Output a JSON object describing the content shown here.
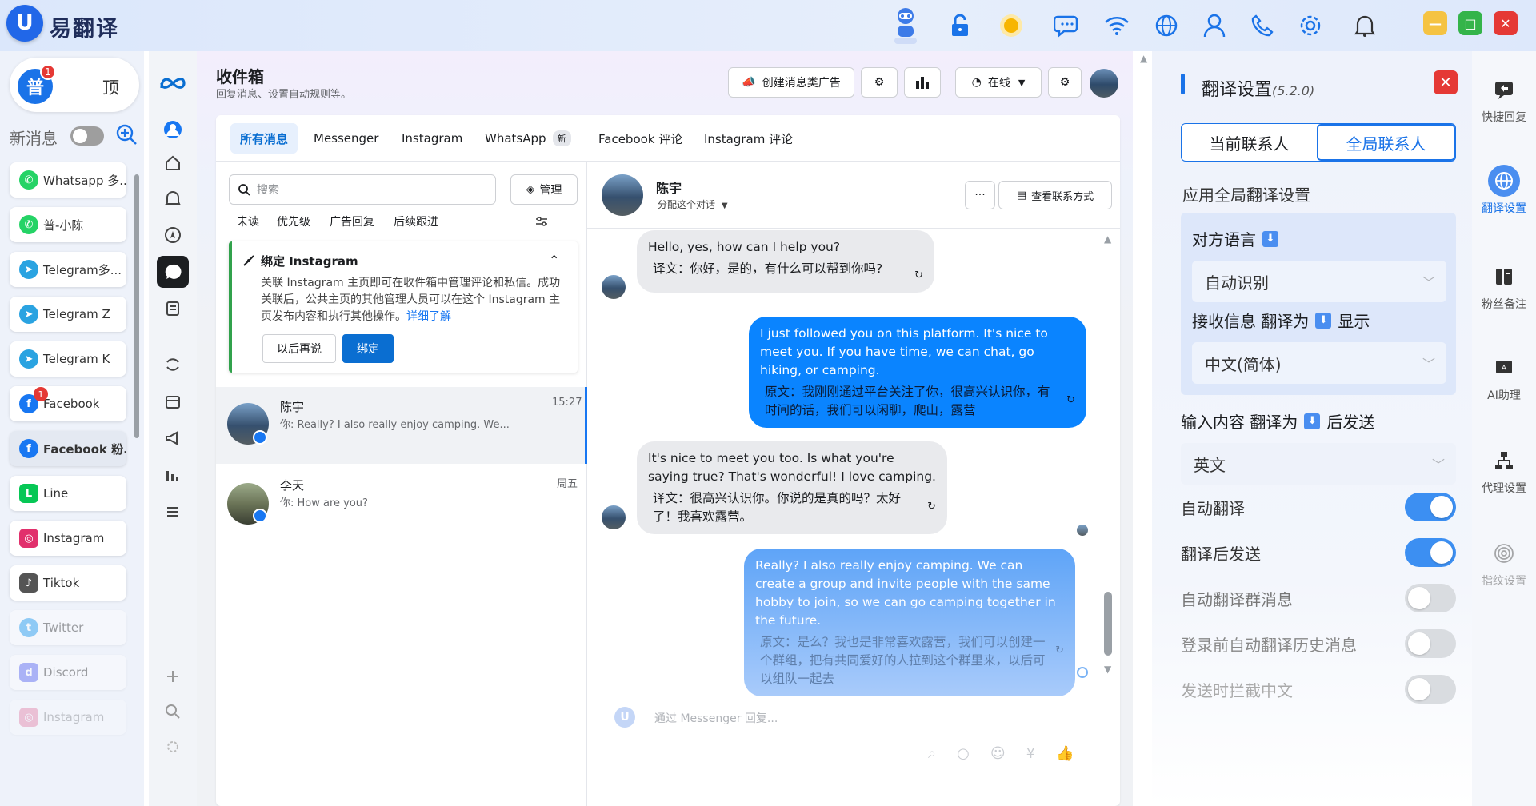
{
  "app": {
    "logo": "U",
    "name": "易翻译"
  },
  "titlebar": {
    "icons": [
      "robot-icon",
      "unlock-icon",
      "sun-icon",
      "chat-bubbles-icon",
      "wifi-icon",
      "globe-icon",
      "user-icon",
      "phone-icon",
      "gear-icon",
      "bell-icon"
    ],
    "window_buttons": [
      "minimize",
      "maximize",
      "close"
    ]
  },
  "account_sidebar": {
    "toggle_left": "普",
    "toggle_badge": "1",
    "toggle_right": "顶",
    "new_message_label": "新消息",
    "accounts": [
      {
        "label": "Whatsapp 多...",
        "icon": "whatsapp-icon",
        "color": "#25d366"
      },
      {
        "label": "普-小陈",
        "icon": "whatsapp-icon",
        "color": "#25d366"
      },
      {
        "label": "Telegram多...",
        "icon": "telegram-icon",
        "color": "#2aa3e1"
      },
      {
        "label": "Telegram Z",
        "icon": "telegram-icon",
        "color": "#2aa3e1"
      },
      {
        "label": "Telegram K",
        "icon": "telegram-icon",
        "color": "#2aa3e1"
      },
      {
        "label": "Facebook",
        "icon": "facebook-icon",
        "color": "#1877f2",
        "badge": "1"
      },
      {
        "label": "Facebook 粉...",
        "icon": "facebook-icon",
        "color": "#1877f2"
      },
      {
        "label": "Line",
        "icon": "line-icon",
        "color": "#06c755"
      },
      {
        "label": "Instagram",
        "icon": "instagram-icon",
        "color": "#e1306c"
      },
      {
        "label": "Tiktok",
        "icon": "tiktok-icon",
        "color": "#111111"
      },
      {
        "label": "Twitter",
        "icon": "twitter-icon",
        "color": "#1d9bf0"
      },
      {
        "label": "Discord",
        "icon": "discord-icon",
        "color": "#5865f2"
      },
      {
        "label": "Instagram",
        "icon": "instagram-icon",
        "color": "#e1306c"
      }
    ]
  },
  "inbox": {
    "title": "收件箱",
    "subtitle": "回复消息、设置自动规则等。",
    "create_ad_label": "创建消息类广告",
    "status_label": "在线",
    "tabs": [
      {
        "label": "所有消息"
      },
      {
        "label": "Messenger"
      },
      {
        "label": "Instagram"
      },
      {
        "label": "WhatsApp",
        "badge": "新"
      },
      {
        "label": "Facebook 评论"
      },
      {
        "label": "Instagram 评论"
      }
    ],
    "search_placeholder": "搜索",
    "manage_label": "管理",
    "filters": [
      "未读",
      "优先级",
      "广告回复",
      "后续跟进"
    ],
    "bind_card": {
      "title": "绑定 Instagram",
      "desc": "关联 Instagram 主页即可在收件箱中管理评论和私信。成功关联后，公共主页的其他管理人员可以在这个 Instagram 主页发布内容和执行其他操作。",
      "link": "详细了解",
      "later_label": "以后再说",
      "bind_label": "绑定"
    },
    "conversations": [
      {
        "name": "陈宇",
        "preview": "你: Really? I also really enjoy camping. We...",
        "time": "15:27"
      },
      {
        "name": "李天",
        "preview": "你: How are you?",
        "time": "周五"
      }
    ]
  },
  "chat": {
    "contact_name": "陈宇",
    "assign_label": "分配这个对话",
    "more_label": "···",
    "contact_info_label": "查看联系方式",
    "messages": [
      {
        "dir": "in",
        "text": "Hello, yes, how can I help you?",
        "translation": "译文：你好，是的，有什么可以帮到你吗?"
      },
      {
        "dir": "out",
        "text": "I just followed you on this platform. It's nice to meet you. If you have time, we can chat, go hiking, or camping.",
        "translation": "原文：我刚刚通过平台关注了你，很高兴认识你，有时间的话，我们可以闲聊，爬山，露营"
      },
      {
        "dir": "in",
        "text": "It's nice to meet you too. Is what you're saying true? That's wonderful! I love camping.",
        "translation": "译文：很高兴认识你。你说的是真的吗？太好了！我喜欢露营。"
      },
      {
        "dir": "out",
        "text": "Really? I also really enjoy camping. We can create a group and invite people with the same hobby to join, so we can go camping together in the future.",
        "translation": "原文：是么？我也是非常喜欢露营，我们可以创建一个群组，把有共同爱好的人拉到这个群里来，以后可以组队一起去"
      }
    ],
    "composer_placeholder": "通过 Messenger 回复..."
  },
  "translation_settings": {
    "title": "翻译设置",
    "version": "(5.2.0)",
    "segment": [
      "当前联系人",
      "全局联系人"
    ],
    "apply_global": "应用全局翻译设置",
    "other_language_label": "对方语言",
    "other_language_value": "自动识别",
    "receive_label_a": "接收信息 翻译为",
    "receive_label_b": "显示",
    "receive_value": "中文(简体)",
    "input_label_a": "输入内容 翻译为",
    "input_label_b": "后发送",
    "input_value": "英文",
    "switches": [
      {
        "label": "自动翻译",
        "on": true
      },
      {
        "label": "翻译后发送",
        "on": true
      },
      {
        "label": "自动翻译群消息",
        "on": false
      },
      {
        "label": "登录前自动翻译历史消息",
        "on": false
      },
      {
        "label": "发送时拦截中文",
        "on": false
      }
    ]
  },
  "tool_rail": [
    {
      "label": "快捷回复",
      "icon": "quick-reply-icon"
    },
    {
      "label": "翻译设置",
      "icon": "translate-icon"
    },
    {
      "label": "粉丝备注",
      "icon": "notes-icon"
    },
    {
      "label": "AI助理",
      "icon": "ai-icon"
    },
    {
      "label": "代理设置",
      "icon": "proxy-icon"
    },
    {
      "label": "指纹设置",
      "icon": "fingerprint-icon"
    }
  ],
  "colors": {
    "accent": "#1a73e8",
    "bubble_out": "#0a84ff",
    "bubble_in": "#e9eaed",
    "danger": "#e53935"
  }
}
